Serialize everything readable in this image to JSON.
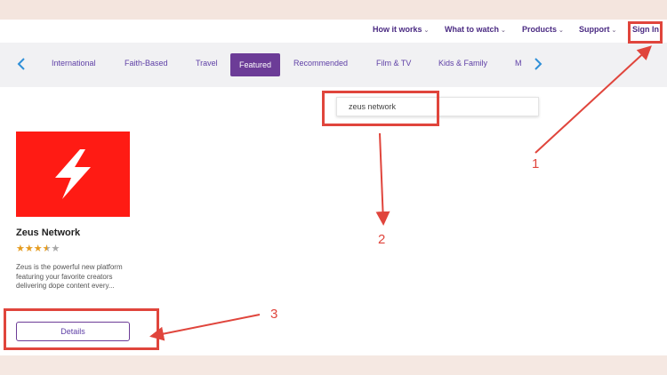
{
  "header": {
    "nav": [
      {
        "label": "How it works"
      },
      {
        "label": "What to watch"
      },
      {
        "label": "Products"
      },
      {
        "label": "Support"
      }
    ],
    "sign_in": "Sign In"
  },
  "categories": {
    "items": [
      "International",
      "Faith-Based",
      "Travel",
      "Featured",
      "Recommended",
      "Film & TV",
      "Kids & Family",
      "M"
    ],
    "active": "Featured"
  },
  "search": {
    "value": "zeus network"
  },
  "app": {
    "title": "Zeus Network",
    "rating_stars": 3.5,
    "rating_max": 5,
    "description": "Zeus is the powerful new platform featuring your favorite creators delivering dope content every...",
    "details_label": "Details",
    "tile_color": "#ff1b14"
  },
  "annotations": {
    "labels": [
      "1",
      "2",
      "3"
    ],
    "color": "#e0453c"
  },
  "colors": {
    "brand": "#6c3c97",
    "nav_text": "#4a2a82"
  }
}
